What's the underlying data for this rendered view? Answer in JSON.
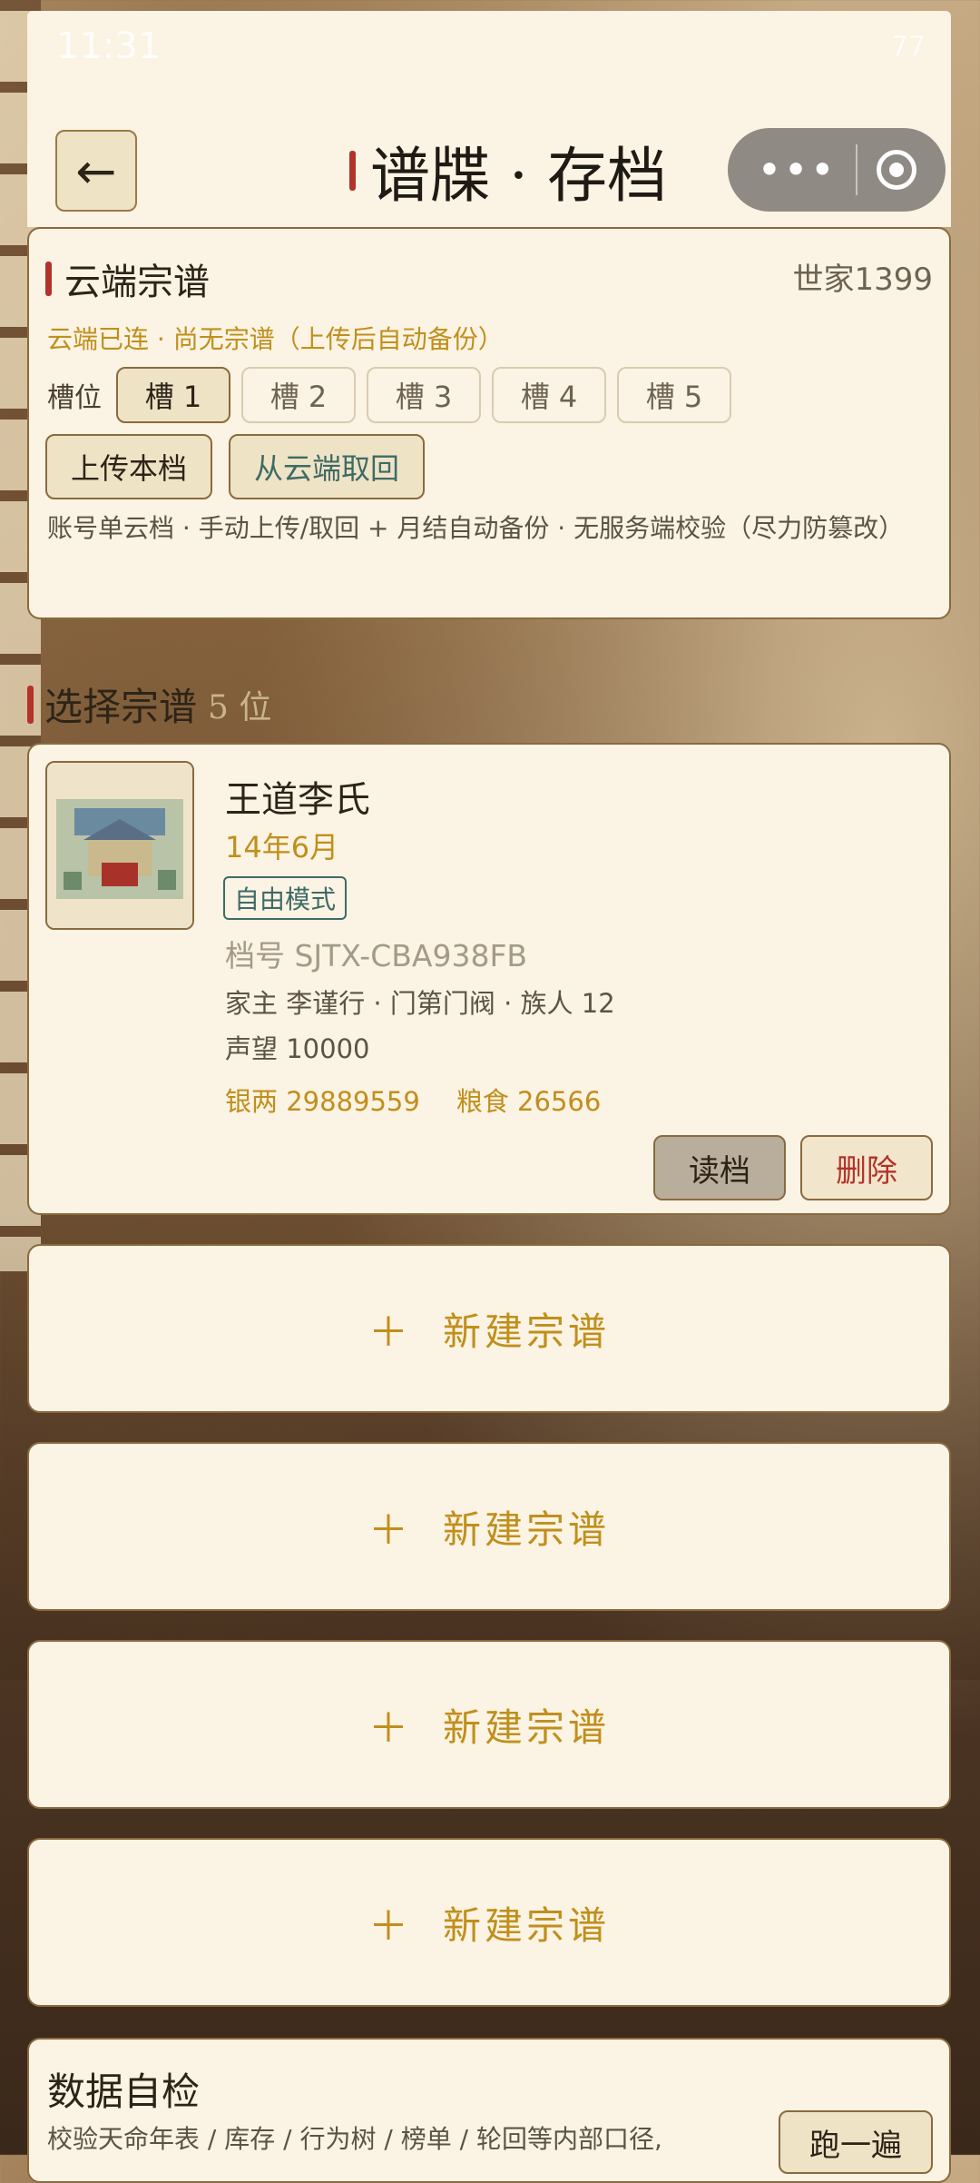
{
  "status_bar": {
    "time": "11:31",
    "battery": "77"
  },
  "header": {
    "back_glyph": "←",
    "title": "谱牒 · 存档"
  },
  "cloud": {
    "title": "云端宗谱",
    "world": "世家1399",
    "status": "云端已连 · 尚无宗谱（上传后自动备份）",
    "slot_label": "槽位",
    "slots": [
      "槽 1",
      "槽 2",
      "槽 3",
      "槽 4",
      "槽 5"
    ],
    "upload_label": "上传本档",
    "fetch_label": "从云端取回",
    "note": "账号单云档 · 手动上传/取回 + 月结自动备份 · 无服务端校验（尽力防篡改）"
  },
  "select": {
    "title": "选择宗谱",
    "count": "5 位"
  },
  "save": {
    "name": "王道李氏",
    "date": "14年6月",
    "mode": "自由模式",
    "id": "档号 SJTX-CBA938FB",
    "line1": "家主 李谨行 · 门第门阀 · 族人 12",
    "line2": "声望 10000",
    "silver": "银两 29889559",
    "grain": "粮食 26566",
    "read_label": "读档",
    "delete_label": "删除"
  },
  "new_slot_label": "新建宗谱",
  "self_check": {
    "title": "数据自检",
    "desc": "校验天命年表 / 库存 / 行为树 / 榜单 / 轮回等内部口径,",
    "run_label": "跑一遍"
  },
  "colors": {
    "accent_gold": "#c08f1c",
    "teal": "#3e6b66",
    "red": "#b3322a",
    "card_bg": "#fbf3e3"
  }
}
